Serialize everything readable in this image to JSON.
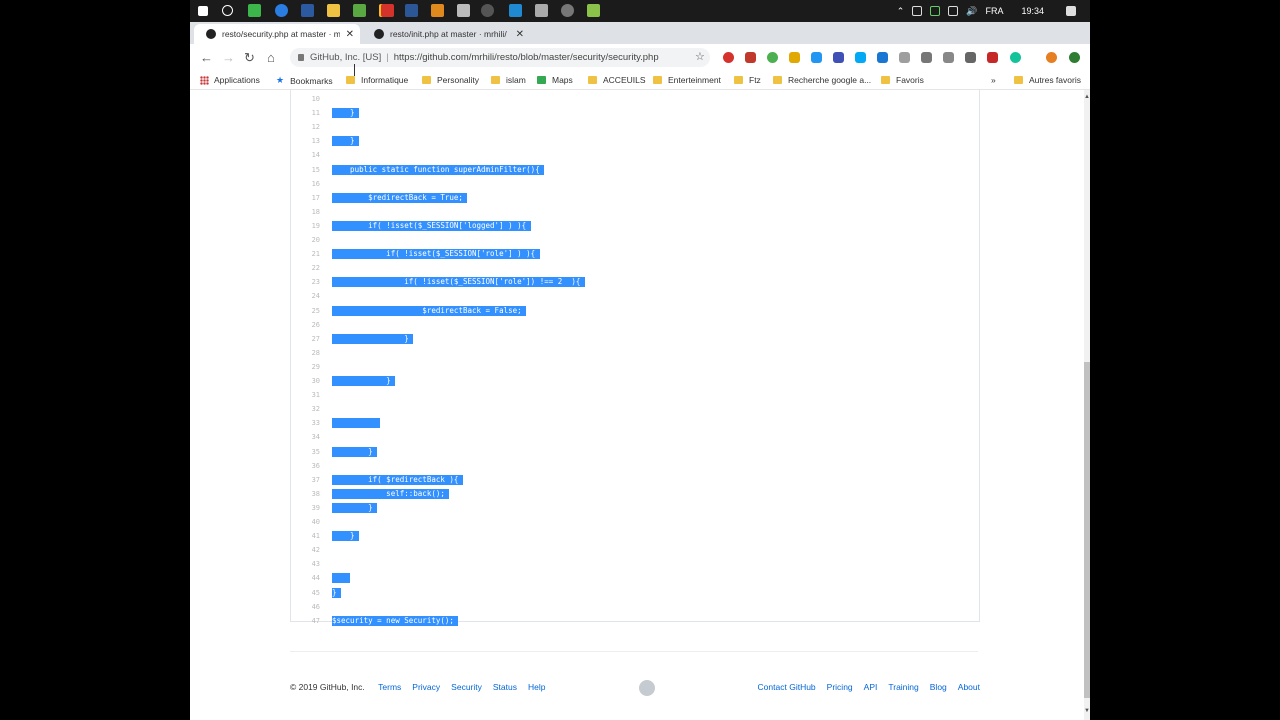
{
  "taskbar": {
    "lang": "FRA",
    "time": "19:34"
  },
  "tabs": [
    {
      "title": "resto/security.php at master · mr",
      "active": true
    },
    {
      "title": "resto/init.php at master · mrhili/",
      "active": false
    }
  ],
  "addressbar": {
    "origin": "GitHub, Inc. [US]",
    "url": "https://github.com/mrhili/resto/blob/master/security/security.php"
  },
  "bookmarks": {
    "apps": "Applications",
    "items": [
      "Bookmarks",
      "Informatique",
      "Personality",
      "islam",
      "Maps",
      "ACCEUILS",
      "Enterteinment",
      "Ftz",
      "Recherche google a...",
      "Favoris"
    ],
    "other": "Autres favoris"
  },
  "code": {
    "lines": [
      {
        "n": "10",
        "text": ""
      },
      {
        "n": "11",
        "text": "    }"
      },
      {
        "n": "12",
        "text": ""
      },
      {
        "n": "13",
        "text": "    }"
      },
      {
        "n": "14",
        "text": ""
      },
      {
        "n": "15",
        "text": "    public static function superAdminFilter(){"
      },
      {
        "n": "16",
        "text": ""
      },
      {
        "n": "17",
        "text": "        $redirectBack = True;"
      },
      {
        "n": "18",
        "text": ""
      },
      {
        "n": "19",
        "text": "        if( !isset($_SESSION['logged'] ) ){"
      },
      {
        "n": "20",
        "text": ""
      },
      {
        "n": "21",
        "text": "            if( !isset($_SESSION['role'] ) ){"
      },
      {
        "n": "22",
        "text": ""
      },
      {
        "n": "23",
        "text": "                if( !isset($_SESSION['role']) !== 2  ){"
      },
      {
        "n": "24",
        "text": ""
      },
      {
        "n": "25",
        "text": "                    $redirectBack = False;"
      },
      {
        "n": "26",
        "text": ""
      },
      {
        "n": "27",
        "text": "                }"
      },
      {
        "n": "28",
        "text": ""
      },
      {
        "n": "29",
        "text": ""
      },
      {
        "n": "30",
        "text": "            }"
      },
      {
        "n": "31",
        "text": ""
      },
      {
        "n": "32",
        "text": ""
      },
      {
        "n": "33",
        "text": ""
      },
      {
        "n": "34",
        "text": ""
      },
      {
        "n": "35",
        "text": "        }"
      },
      {
        "n": "36",
        "text": ""
      },
      {
        "n": "37",
        "text": "        if( $redirectBack ){"
      },
      {
        "n": "38",
        "text": "            self::back();"
      },
      {
        "n": "39",
        "text": "        }"
      },
      {
        "n": "40",
        "text": ""
      },
      {
        "n": "41",
        "text": "    }"
      },
      {
        "n": "42",
        "text": ""
      },
      {
        "n": "43",
        "text": ""
      },
      {
        "n": "44",
        "text": ""
      },
      {
        "n": "45",
        "text": "}"
      },
      {
        "n": "46",
        "text": ""
      },
      {
        "n": "47",
        "text": "$security = new Security();"
      }
    ]
  },
  "footer": {
    "copyright": "© 2019 GitHub, Inc.",
    "left_links": [
      "Terms",
      "Privacy",
      "Security",
      "Status",
      "Help"
    ],
    "right_links": [
      "Contact GitHub",
      "Pricing",
      "API",
      "Training",
      "Blog",
      "About"
    ]
  }
}
